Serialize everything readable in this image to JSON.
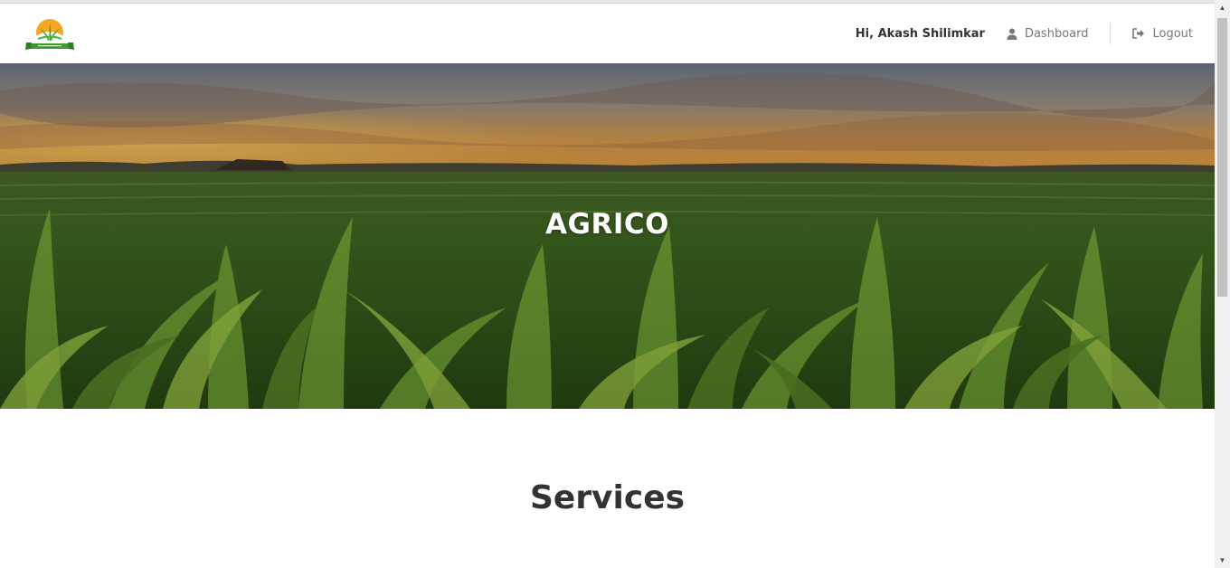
{
  "navbar": {
    "logo_icon": "agrico-logo-icon",
    "greeting": "Hi, Akash Shilimkar",
    "dashboard": {
      "label": "Dashboard",
      "icon": "user-icon"
    },
    "logout": {
      "label": "Logout",
      "icon": "sign-out-icon"
    }
  },
  "hero": {
    "title": "AGRICO",
    "background": "cornfield-sunset-photo"
  },
  "services": {
    "title": "Services"
  },
  "colors": {
    "text_dark": "#333333",
    "text_muted": "#777777",
    "logo_green": "#4caf3a",
    "logo_orange": "#f5a623"
  }
}
